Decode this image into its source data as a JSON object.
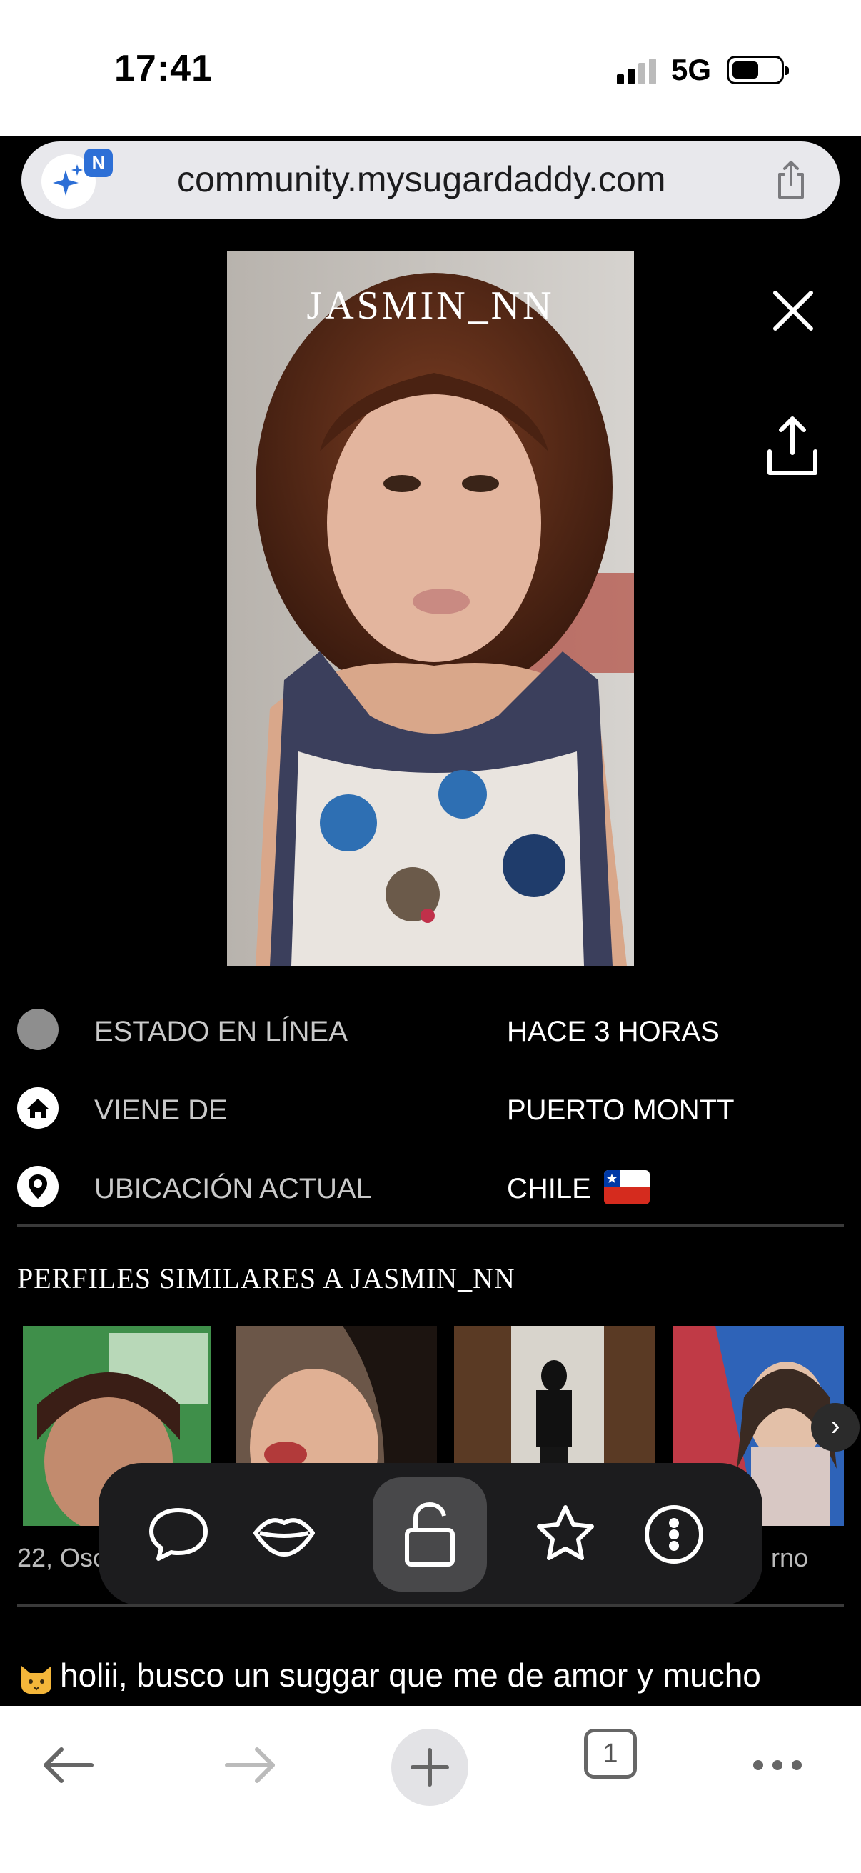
{
  "status_bar": {
    "time": "17:41",
    "network": "5G"
  },
  "browser": {
    "url": "community.mysugardaddy.com",
    "ai_badge": "N",
    "tab_count": "1"
  },
  "profile": {
    "username": "JASMIN_NN",
    "info": [
      {
        "icon": "status-dot-icon",
        "label": "ESTADO EN LÍNEA",
        "value": "HACE 3 HORAS"
      },
      {
        "icon": "home-icon",
        "label": "VIENE DE",
        "value": "PUERTO MONTT"
      },
      {
        "icon": "location-pin-icon",
        "label": "UBICACIÓN ACTUAL",
        "value": "CHILE"
      }
    ],
    "similar_title": "PERFILES SIMILARES A JASMIN_NN",
    "similar_captions": [
      "22, Oso",
      "rno"
    ],
    "bio": "holii, busco un suggar que me de amor y mucho"
  },
  "colors": {
    "status_dot": "#8e8e8e",
    "divider": "#3a3a3a",
    "url_bar": "#e8e8ec"
  }
}
